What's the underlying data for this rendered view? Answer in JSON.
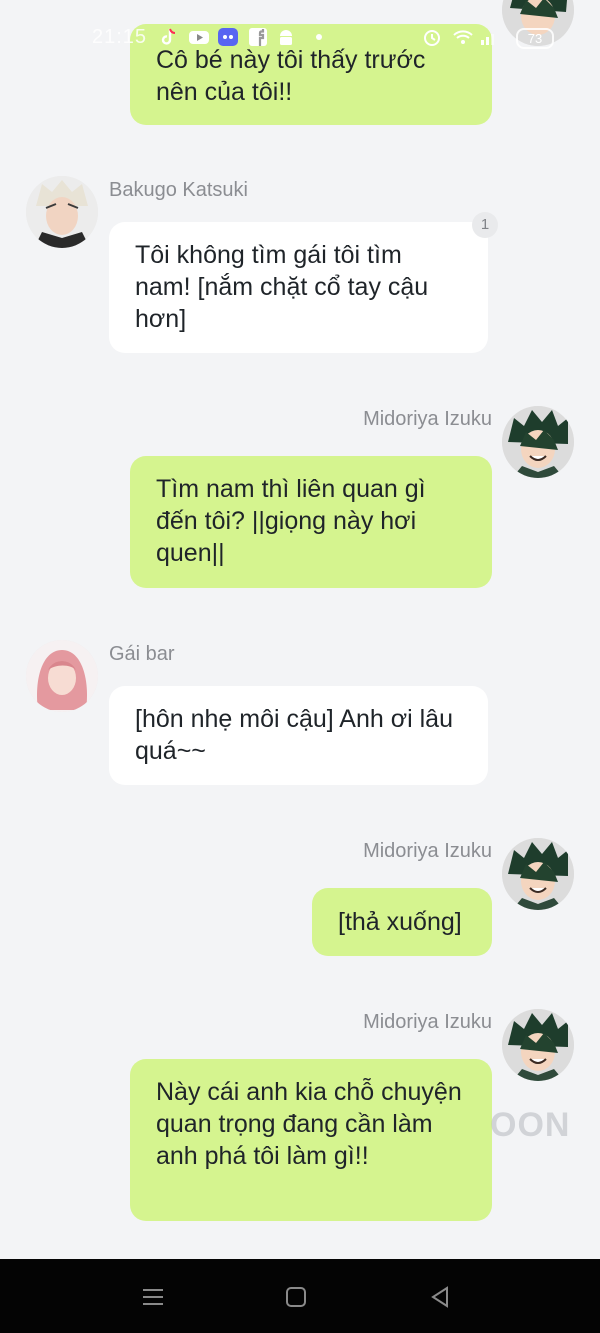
{
  "status_bar": {
    "time": "21:15",
    "battery": "73",
    "icons": [
      "tiktok-icon",
      "youtube-icon",
      "discord-icon",
      "facebook-icon",
      "android-icon",
      "dot-icon",
      "alarm-icon",
      "wifi-icon",
      "signal-icon",
      "battery-icon"
    ]
  },
  "colors": {
    "mine_bubble": "#d5f48f",
    "their_bubble": "#ffffff",
    "background": "#f3f4f6",
    "name": "#8b8d92"
  },
  "messages": [
    {
      "sender": "",
      "side": "right",
      "text": "Cô bé này tôi thấy trước nên của tôi!!"
    },
    {
      "sender": "Bakugo Katsuki",
      "side": "left",
      "text": "Tôi không tìm gái tôi tìm nam! [nắm chặt cổ tay cậu hơn]",
      "badge": "1"
    },
    {
      "sender": "Midoriya Izuku",
      "side": "right",
      "text": "Tìm nam thì liên quan gì đến tôi? ||giọng này hơi quen||"
    },
    {
      "sender": "Gái bar",
      "side": "left",
      "text": "[hôn nhẹ môi cậu] Anh ơi lâu quá~~"
    },
    {
      "sender": "Midoriya Izuku",
      "side": "right",
      "text": "[thả xuống]"
    },
    {
      "sender": "Midoriya Izuku",
      "side": "right",
      "text": "Này cái anh kia chỗ chuyện quan trọng đang cần làm anh phá tôi làm gì!!"
    }
  ],
  "watermark": "OON",
  "nav": {
    "icons": [
      "menu-icon",
      "home-icon",
      "back-icon"
    ]
  }
}
